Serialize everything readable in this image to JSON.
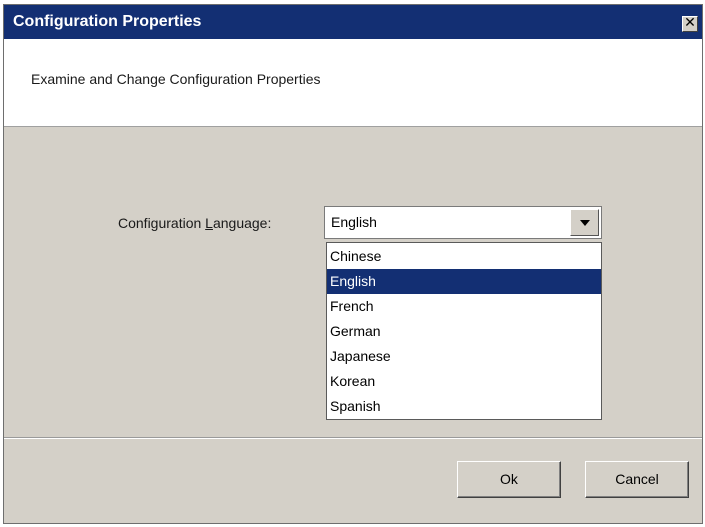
{
  "window": {
    "title": "Configuration Properties",
    "close_glyph": "✕"
  },
  "header": {
    "description": "Examine and Change Configuration Properties"
  },
  "form": {
    "language_label_prefix": "Configuration ",
    "language_label_mnemonic": "L",
    "language_label_suffix": "anguage:",
    "language_selected": "English",
    "language_options": [
      "Chinese",
      "English",
      "French",
      "German",
      "Japanese",
      "Korean",
      "Spanish"
    ],
    "dropdown_open": true
  },
  "buttons": {
    "ok_label": "Ok",
    "cancel_label": "Cancel"
  },
  "colors": {
    "title_bar": "#132f73",
    "selection": "#132f73",
    "dialog_bg": "#d4d0c8"
  }
}
